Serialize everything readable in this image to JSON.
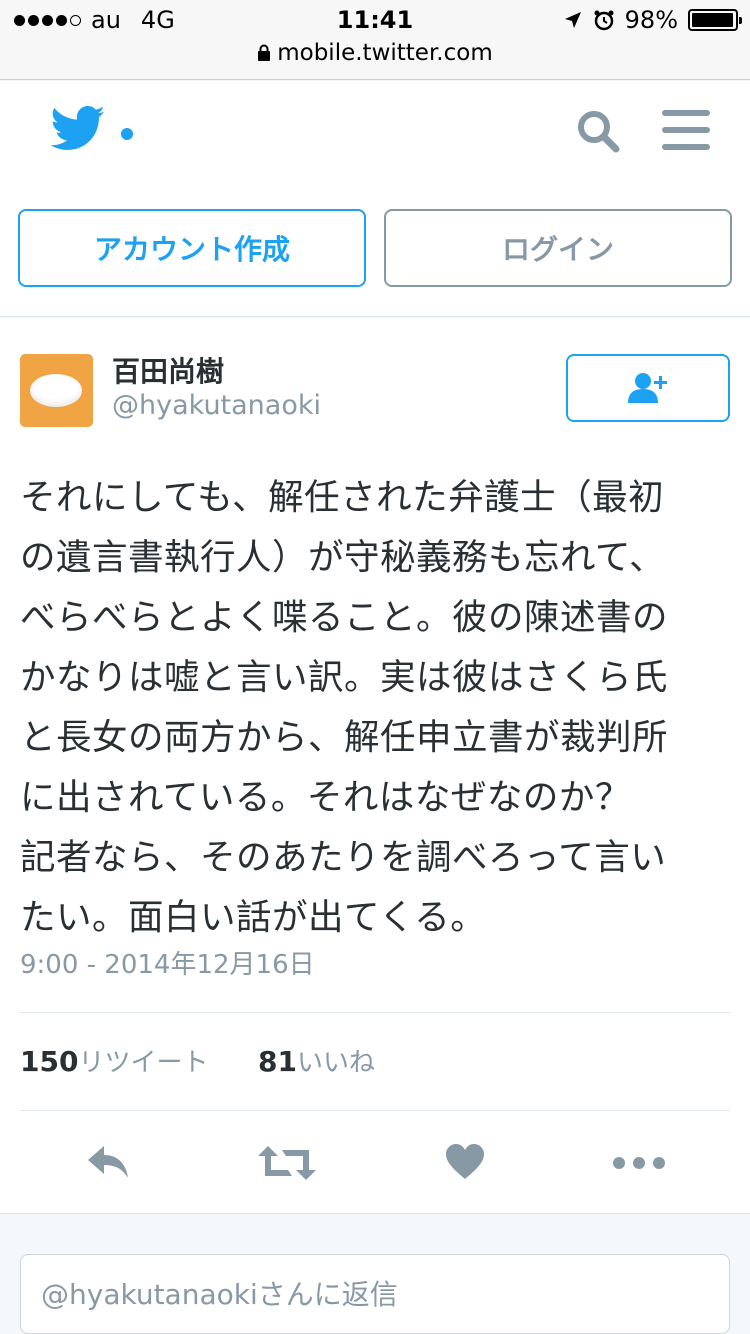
{
  "status_bar": {
    "carrier": "au",
    "network": "4G",
    "time": "11:41",
    "battery": "98%",
    "battery_level": 0.98,
    "url": "mobile.twitter.com"
  },
  "header": {
    "logo": "twitter-bird-icon",
    "signup_label": "アカウント作成",
    "login_label": "ログイン",
    "brand_color": "#1da1f2"
  },
  "tweet": {
    "author_name": "百田尚樹",
    "author_handle": "@hyakutanaoki",
    "text": "それにしても、解任された弁護士（最初\nの遺言書執行人）が守秘義務も忘れて、\nべらべらとよく喋ること。彼の陳述書の\nかなりは嘘と言い訳。実は彼はさくら氏\nと長女の両方から、解任申立書が裁判所\nに出されている。それはなぜなのか？\n記者なら、そのあたりを調べろって言い\nたい。面白い話が出てくる。",
    "timestamp": "9:00 - 2014年12月16日",
    "retweet_count": "150",
    "retweet_label": "リツイート",
    "like_count": "81",
    "like_label": "いいね"
  },
  "reply": {
    "placeholder": "@hyakutanaokiさんに返信"
  }
}
